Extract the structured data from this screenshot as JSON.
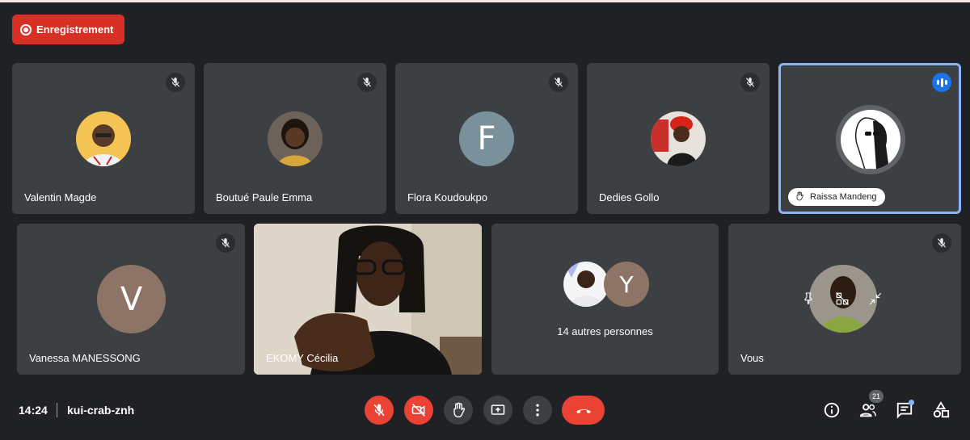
{
  "recording": {
    "label": "Enregistrement"
  },
  "participants": [
    {
      "name": "Valentin Magde"
    },
    {
      "name": "Boutué Paule Emma"
    },
    {
      "name": "Flora Koudoukpo",
      "initial": "F"
    },
    {
      "name": "Dedies Gollo"
    },
    {
      "name": "Raissa Mandeng"
    },
    {
      "name": "Vanessa MANESSONG",
      "initial": "V"
    },
    {
      "name": "EKOMY Cécilia"
    },
    {
      "name": "Vous"
    }
  ],
  "others": {
    "initial": "Y",
    "label": "14 autres personnes"
  },
  "meeting": {
    "time": "14:24",
    "code": "kui-crab-znh"
  },
  "people_count": "21",
  "colors": {
    "accent": "#8ab4f8",
    "danger": "#ea4335",
    "tile": "#3c4043",
    "background": "#202124",
    "flora_avatar": "#7a909b",
    "vanessa_avatar": "#8d7467",
    "others_avatar": "#8d7467"
  },
  "icons": {
    "mute": "mic-off-icon",
    "speaking": "audio-level-icon",
    "raise_hand": "raise-hand-icon",
    "controls": [
      "mic-off-icon",
      "camera-off-icon",
      "raise-hand-icon",
      "present-screen-icon",
      "more-options-icon",
      "hang-up-icon"
    ],
    "side": [
      "info-icon",
      "people-icon",
      "chat-icon",
      "activities-icon"
    ],
    "self_overlay": [
      "pin-icon",
      "remove-tile-icon",
      "minimize-icon"
    ]
  }
}
